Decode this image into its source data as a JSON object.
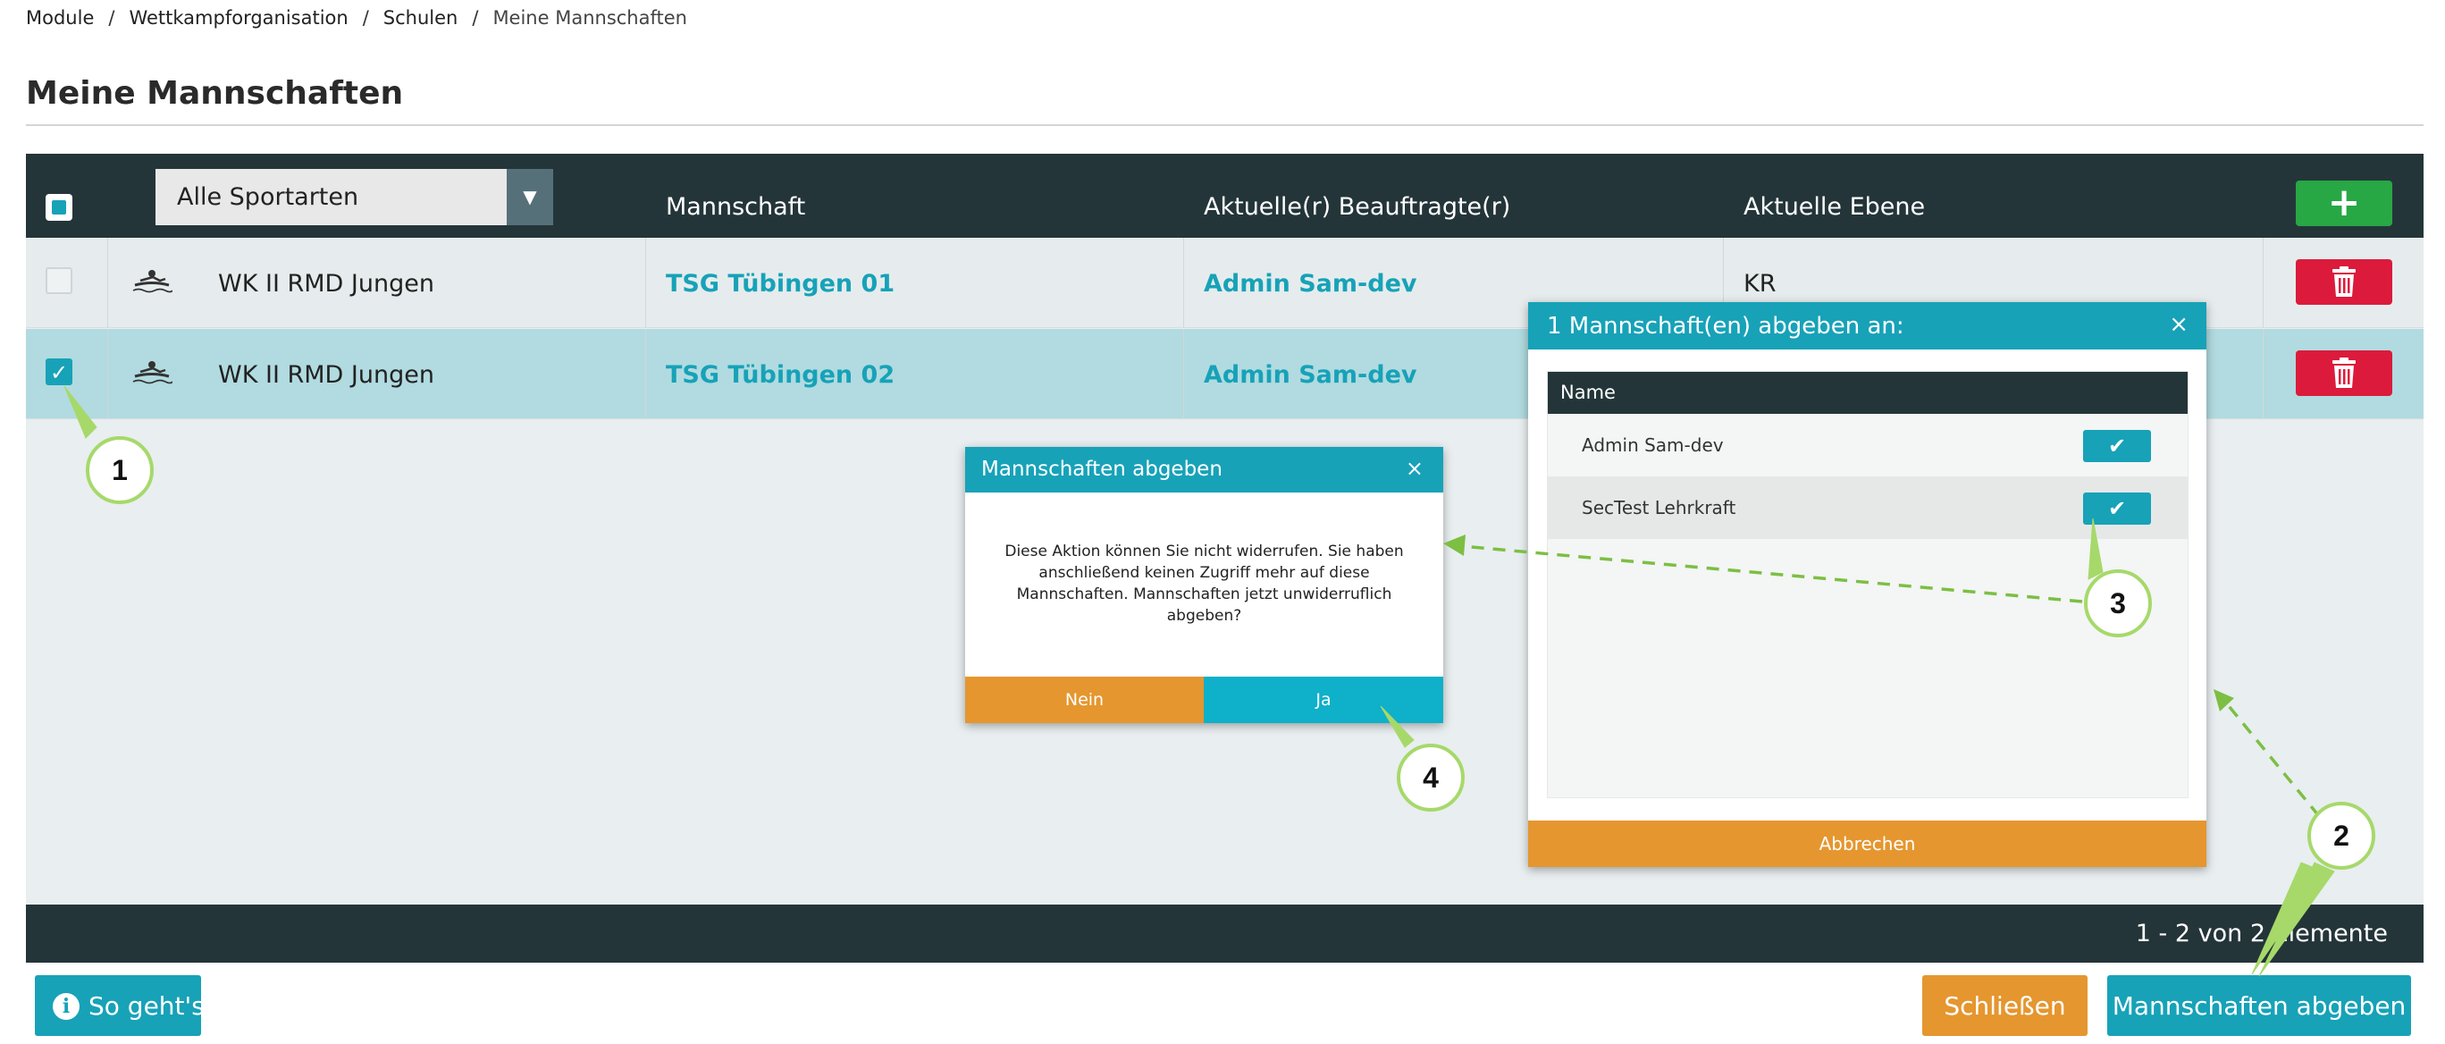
{
  "breadcrumb": [
    "Module",
    "Wettkampforganisation",
    "Schulen",
    "Meine Mannschaften"
  ],
  "breadcrumb_separator": "/",
  "page_title": "Meine Mannschaften",
  "grid": {
    "filter_value": "Alle Sportarten",
    "columns": {
      "team": "Mannschaft",
      "owner": "Aktuelle(r) Beauftragte(r)",
      "level": "Aktuelle Ebene"
    },
    "add_icon": "plus-icon",
    "delete_icon": "trash-icon",
    "rows": [
      {
        "checked": false,
        "sport_icon": "rowing-icon",
        "competition": "WK II RMD Jungen",
        "team": "TSG Tübingen 01",
        "owner": "Admin Sam-dev",
        "level": "KR"
      },
      {
        "checked": true,
        "sport_icon": "rowing-icon",
        "competition": "WK II RMD Jungen",
        "team": "TSG Tübingen 02",
        "owner": "Admin Sam-dev",
        "level": ""
      }
    ],
    "pager": "1 - 2 von 2 Elemente"
  },
  "buttons": {
    "help": "So geht's",
    "close": "Schließen",
    "submit": "Mannschaften abgeben"
  },
  "dialog_assign": {
    "title": "1 Mannschaft(en) abgeben an:",
    "close_symbol": "×",
    "list_header": "Name",
    "items": [
      "Admin Sam-dev",
      "SecTest Lehrkraft"
    ],
    "cancel": "Abbrechen"
  },
  "dialog_confirm": {
    "title": "Mannschaften abgeben",
    "close_symbol": "×",
    "message": "Diese Aktion können Sie nicht widerrufen. Sie haben anschließend keinen Zugriff mehr auf diese Mannschaften. Mannschaften jetzt unwiderruflich abgeben?",
    "no": "Nein",
    "yes": "Ja"
  },
  "callouts": [
    "1",
    "2",
    "3",
    "4"
  ],
  "colors": {
    "accent": "#17a2b8",
    "header_dark": "#243539",
    "orange": "#e5962f",
    "danger": "#dc1a3c",
    "success": "#28a745",
    "callout_border": "#a6d96a",
    "selected_row": "#b1dbe0"
  }
}
